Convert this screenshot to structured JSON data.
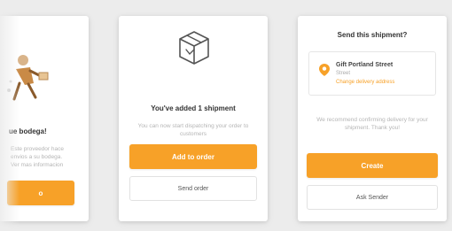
{
  "left_card": {
    "heading": "ue bodega!",
    "body": "Este proveedor hace envios a su bodega. Ver mas informacion",
    "button_label": "o"
  },
  "middle_card": {
    "icon": "box-icon",
    "heading": "You've added 1 shipment",
    "body": "You can now start dispatching your order to customers",
    "primary_label": "Add to order",
    "secondary_label": "Send order"
  },
  "right_card": {
    "title": "Send this shipment?",
    "address": {
      "icon": "location-pin-icon",
      "name": "Gift Portland Street",
      "line": "Street",
      "link": "Change delivery address"
    },
    "body": "We recommend confirming delivery for your shipment. Thank you!",
    "primary_label": "Create",
    "secondary_label": "Ask Sender"
  },
  "colors": {
    "accent": "#f7a128",
    "background": "#ececec",
    "card": "#ffffff"
  }
}
